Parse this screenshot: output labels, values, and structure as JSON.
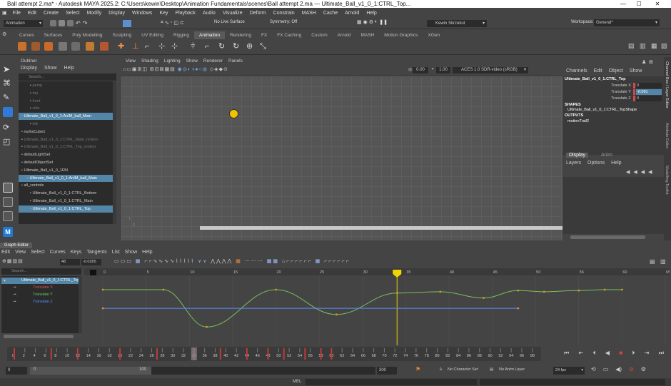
{
  "window": {
    "title": "Ball attempt 2.ma* - Autodesk MAYA 2025.2: C:\\Users\\kewin\\Desktop\\Animation Fundamentals\\scenes\\Ball attempt 2.ma   ---   Ultimate_Ball_v1_0_1:CTRL_Top..."
  },
  "menu": [
    "File",
    "Edit",
    "Create",
    "Select",
    "Modify",
    "Display",
    "Windows",
    "Key",
    "Playback",
    "Audio",
    "Visualize",
    "Deform",
    "Constrain",
    "MASH",
    "Cache",
    "Arnold",
    "Help"
  ],
  "status": {
    "mode": "Animation",
    "live_surface": "No Live Surface",
    "symmetry": "Symmetry: Off",
    "user": "Kewin Skrzekut",
    "workspace_label": "Workspace:",
    "workspace_value": "General*"
  },
  "shelf_tabs": [
    "Curves",
    "Surfaces",
    "Poly Modelling",
    "Sculpting",
    "UV Editing",
    "Rigging",
    "Animation",
    "Rendering",
    "FX",
    "FX Caching",
    "Custom",
    "Arnold",
    "MASH",
    "Motion Graphics",
    "XGen"
  ],
  "shelf_active": "Animation",
  "outliner": {
    "title": "Outliner",
    "menu": [
      "Display",
      "Show",
      "Help"
    ],
    "search_placeholder": "Search...",
    "items": [
      {
        "label": "persp",
        "dim": true,
        "sel": false
      },
      {
        "label": "top",
        "dim": true,
        "sel": false
      },
      {
        "label": "front",
        "dim": true,
        "sel": false
      },
      {
        "label": "side",
        "dim": true,
        "sel": false
      },
      {
        "label": "Ultimate_Ball_v1_0_1:AnIM_ball_Main",
        "dim": false,
        "sel": true
      },
      {
        "label": "left",
        "dim": true,
        "sel": false
      },
      {
        "label": "nurbsCube1",
        "dim": false,
        "sel": false
      },
      {
        "label": "Ultimate_Ball_v1_0_1:CTRL_Main_motion",
        "dim": true,
        "sel": false
      },
      {
        "label": "Ultimate_Ball_v1_0_1:CTRL_Top_motion",
        "dim": true,
        "sel": false
      },
      {
        "label": "defaultLightSet",
        "dim": false,
        "sel": false
      },
      {
        "label": "defaultObjectSet",
        "dim": false,
        "sel": false
      },
      {
        "label": "Ultimate_Ball_v1_0_1RN",
        "dim": false,
        "sel": false
      },
      {
        "label": "Ultimate_Ball_v1_0_1:AnIM_ball_Main",
        "dim": false,
        "sel": true
      },
      {
        "label": "all_controls",
        "dim": false,
        "sel": false
      },
      {
        "label": "Ultimate_Ball_v1_0_1:CTRL_Bottom",
        "dim": false,
        "sel": false
      },
      {
        "label": "Ultimate_Ball_v1_0_1:CTRL_Main",
        "dim": false,
        "sel": false
      },
      {
        "label": "Ultimate_Ball_v1_0_1:CTRL_Top",
        "dim": false,
        "sel": true
      }
    ]
  },
  "viewport": {
    "menu": [
      "View",
      "Shading",
      "Lighting",
      "Show",
      "Renderer",
      "Panels"
    ],
    "field1": "0.00",
    "field2": "1.00",
    "colorspace": "ACES 1.0 SDR-video (sRGB)"
  },
  "channel_box": {
    "menu": [
      "Channels",
      "Edit",
      "Object",
      "Show"
    ],
    "object": "Ultimate_Ball_v1_0_1:CTRL_Top",
    "channels": [
      {
        "name": "Translate X",
        "value": "0"
      },
      {
        "name": "Translate Y",
        "value": "-0.081"
      },
      {
        "name": "Translate Z",
        "value": "0"
      }
    ],
    "shapes_label": "SHAPES",
    "shape": "Ultimate_Ball_v1_0_1:CTRL_TopShape",
    "outputs_label": "OUTPUTS",
    "output": "motionTrail2",
    "tabs": [
      "Display",
      "Anim"
    ],
    "layer_menu": [
      "Layers",
      "Options",
      "Help"
    ]
  },
  "side_tabs": [
    "Channel Box / Layer Editor",
    "Attribute Editor",
    "Modelling Toolkit"
  ],
  "graph_editor": {
    "title": "Graph Editor",
    "menu": [
      "Edit",
      "View",
      "Select",
      "Curves",
      "Keys",
      "Tangents",
      "List",
      "Show",
      "Help"
    ],
    "frame_field": "48",
    "value_field": "-0.0265",
    "search_placeholder": "Search...",
    "tracks": [
      {
        "label": "Ultimate_Ball_v1_0_1:CTRL_Top",
        "color": "#9fd0ff"
      },
      {
        "label": "Translate X",
        "color": "#d65050"
      },
      {
        "label": "Translate Y",
        "color": "#64c864"
      },
      {
        "label": "Translate Z",
        "color": "#5a8cff"
      }
    ],
    "ruler_labels": [
      "0",
      "5",
      "10",
      "15",
      "20",
      "25",
      "30",
      "35",
      "40",
      "45",
      "50",
      "55",
      "60",
      "65"
    ],
    "current_frame": "34"
  },
  "chart_data": {
    "type": "line",
    "title": "",
    "xlabel": "",
    "ylabel": "",
    "xlim": [
      -1,
      65
    ],
    "series": [
      {
        "name": "Translate Y",
        "color": "#7cbf5a",
        "points": [
          [
            0,
            0.0
          ],
          [
            7,
            0.0
          ],
          [
            12,
            -0.9
          ],
          [
            20,
            0.0
          ],
          [
            27,
            -0.6
          ],
          [
            34,
            -0.081
          ],
          [
            39,
            -0.05
          ],
          [
            44,
            -0.2
          ],
          [
            48,
            -0.02
          ],
          [
            51,
            -0.05
          ],
          [
            55,
            -0.02
          ],
          [
            58,
            0.0
          ],
          [
            60,
            0.0
          ]
        ]
      },
      {
        "name": "Translate Z",
        "color": "#5a8cff",
        "points": [
          [
            0,
            -0.45
          ],
          [
            48,
            -0.45
          ]
        ]
      }
    ]
  },
  "timeline": {
    "ticks": [
      "0",
      "2",
      "4",
      "6",
      "8",
      "10",
      "12",
      "14",
      "16",
      "18",
      "20",
      "22",
      "24",
      "26",
      "28",
      "30",
      "32",
      "34",
      "36",
      "38",
      "40",
      "42",
      "44",
      "46",
      "48",
      "50",
      "52",
      "54",
      "56",
      "58",
      "60",
      "62",
      "64",
      "66",
      "68",
      "70",
      "72",
      "74",
      "76",
      "78",
      "80",
      "82",
      "84",
      "86",
      "88",
      "90",
      "92",
      "94",
      "96",
      "98",
      "10"
    ],
    "keys": [
      0,
      7,
      12,
      20,
      27,
      34,
      39,
      44,
      48,
      51,
      55,
      58,
      60
    ],
    "current": 34
  },
  "range": {
    "start": "0",
    "inner_start": "0",
    "inner_end": "100",
    "end": "300",
    "character_set": "No Character Set",
    "anim_layer": "No Anim Layer",
    "fps": "24 fps"
  },
  "command": {
    "label": "MEL"
  }
}
